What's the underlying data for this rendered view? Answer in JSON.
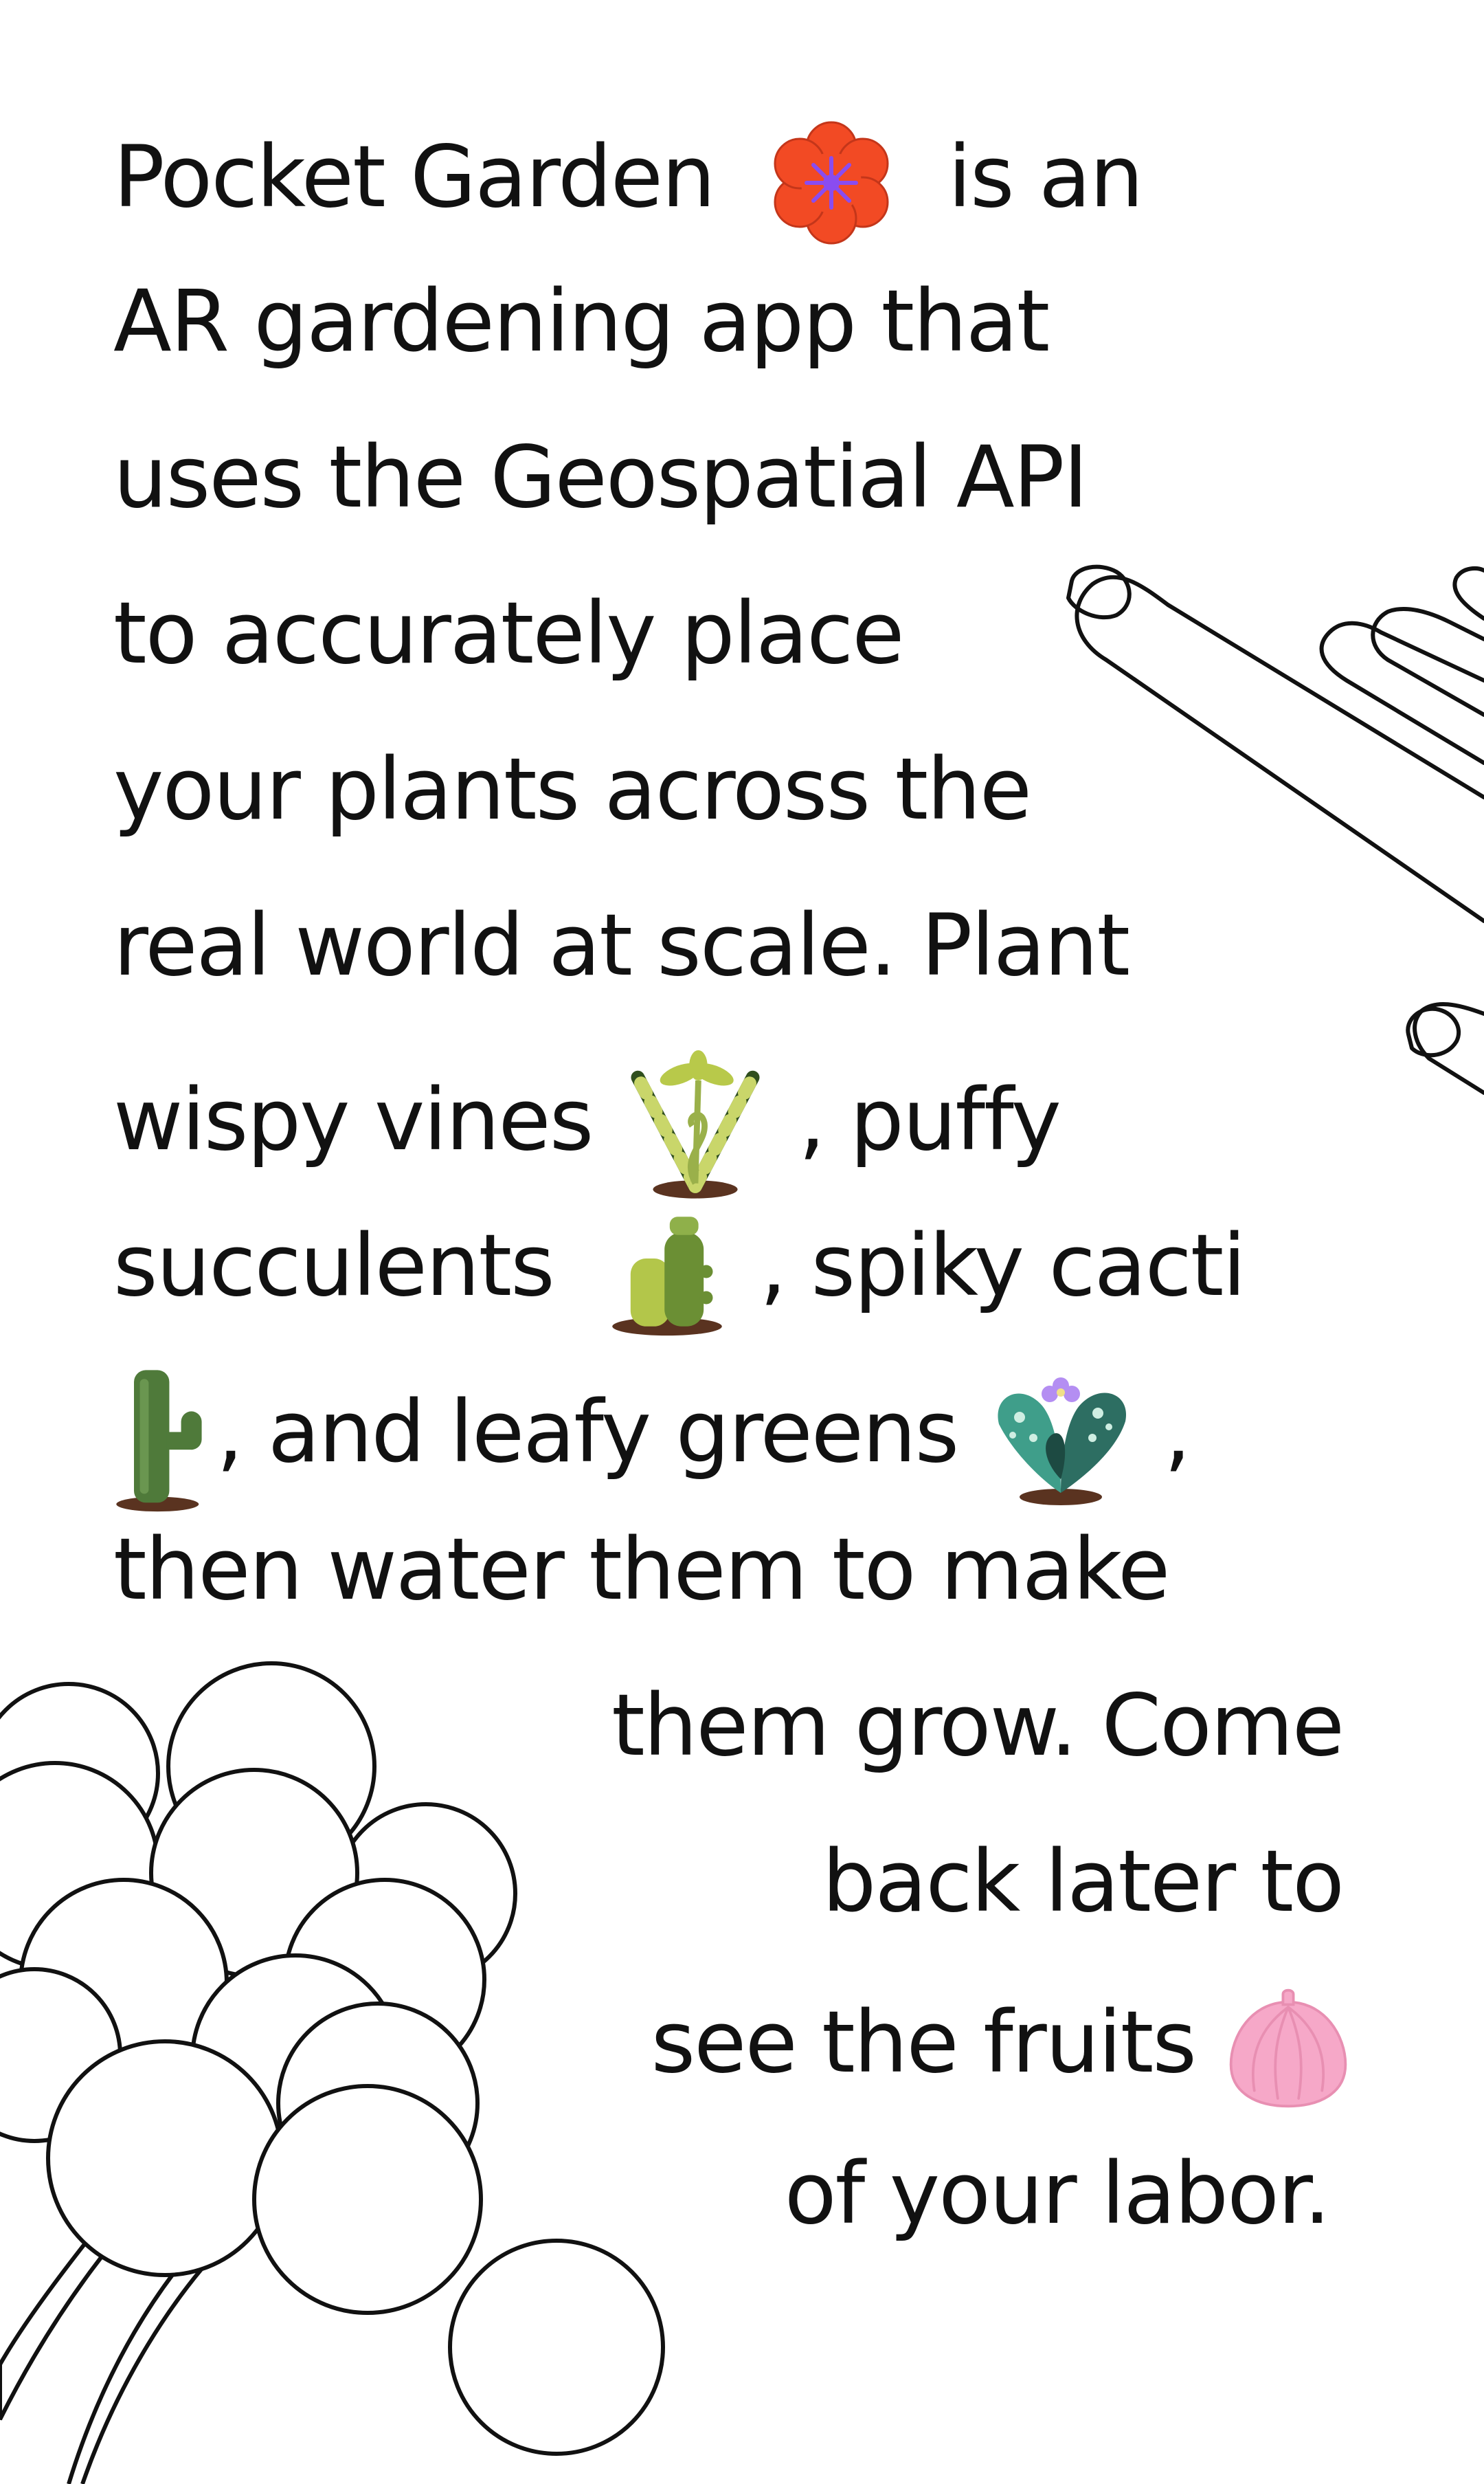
{
  "colors": {
    "text": "#111111",
    "background": "#ffffff",
    "flower_petal": "#f24a24",
    "flower_center": "#8a4cf0",
    "fruit_pink": "#f6a8c8",
    "cactus_green": "#4f7a3a",
    "succulent_green": "#9ab04a",
    "soil": "#5a3320"
  },
  "paragraph": {
    "l1": {
      "a": "Pocket Garden",
      "b": "is an"
    },
    "l2": "AR gardening app that",
    "l3": "uses the Geospatial API",
    "l4": "to accurately place",
    "l5": "your plants across the",
    "l6": "real world at scale. Plant",
    "l7": {
      "a": "wispy vines",
      "b": ", puffy"
    },
    "l8": {
      "a": "succulents",
      "b": ", spiky cacti"
    },
    "l9": {
      "a": ", and leafy greens",
      "b": ","
    },
    "l10": "then water them to make",
    "l11": "them grow. Come",
    "l12": "back later to",
    "l13": {
      "a": "see the fruits"
    },
    "l14": "of your labor."
  },
  "icons": {
    "flower": "red-flower-icon",
    "vine": "vine-plant-icon",
    "succulent": "succulent-icon",
    "cactus": "cactus-icon",
    "leafy": "leafy-greens-icon",
    "fruit": "pink-fruit-icon",
    "hand": "hand-illustration",
    "tree": "tree-illustration"
  }
}
